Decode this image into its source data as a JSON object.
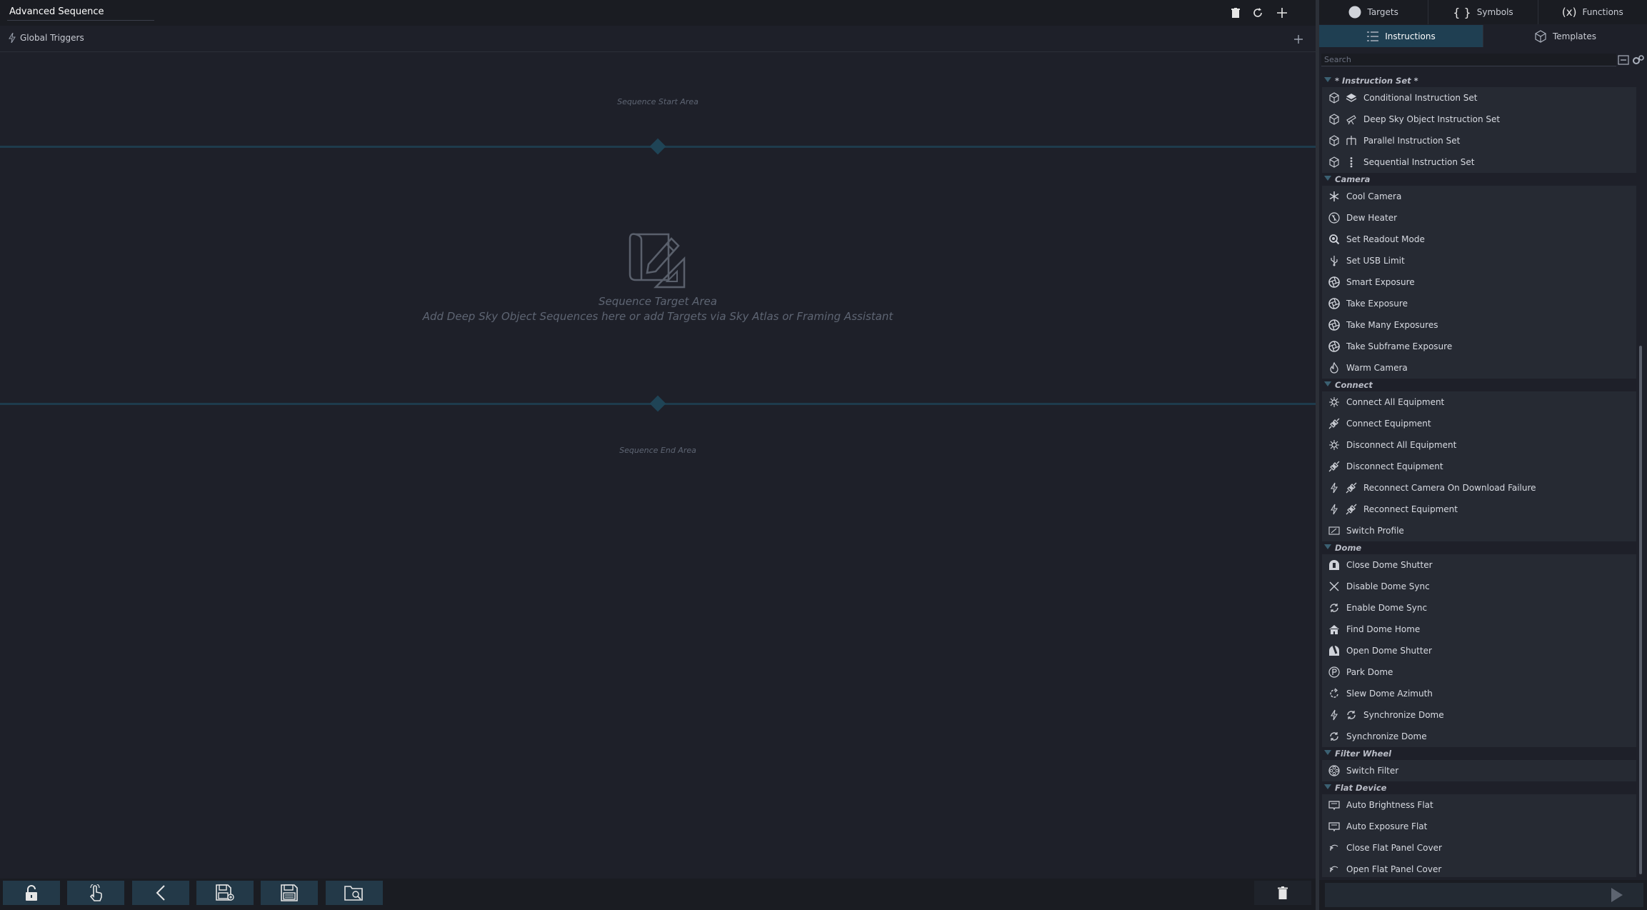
{
  "sequence": {
    "name": "Advanced Sequence",
    "global_triggers_label": "Global Triggers",
    "start_area_label": "Sequence Start Area",
    "target_area_title": "Sequence Target Area",
    "target_area_hint": "Add Deep Sky Object Sequences here or add Targets via Sky Atlas or Framing Assistant",
    "end_area_label": "Sequence End Area"
  },
  "tabs_top": [
    {
      "label": "Targets",
      "icon": "circle-icon"
    },
    {
      "label": "Symbols",
      "icon": "braces-icon"
    },
    {
      "label": "Functions",
      "icon": "function-x-icon"
    }
  ],
  "tabs_bottom": [
    {
      "label": "Instructions",
      "icon": "list-icon",
      "active": true
    },
    {
      "label": "Templates",
      "icon": "cube-icon",
      "active": false
    }
  ],
  "search": {
    "placeholder": "Search"
  },
  "categories": [
    {
      "name": "* Instruction Set *",
      "items": [
        {
          "label": "Conditional Instruction Set",
          "icon": "cube-icon",
          "icon2": "layers-icon"
        },
        {
          "label": "Deep Sky Object Instruction Set",
          "icon": "cube-icon",
          "icon2": "telescope-icon"
        },
        {
          "label": "Parallel Instruction Set",
          "icon": "cube-icon",
          "icon2": "parallel-icon"
        },
        {
          "label": "Sequential Instruction Set",
          "icon": "cube-icon",
          "icon2": "dots-vertical-icon"
        }
      ]
    },
    {
      "name": "Camera",
      "items": [
        {
          "label": "Cool Camera",
          "icon": "snowflake-icon"
        },
        {
          "label": "Dew Heater",
          "icon": "dew-heater-icon"
        },
        {
          "label": "Set Readout Mode",
          "icon": "magnifier-icon"
        },
        {
          "label": "Set USB Limit",
          "icon": "usb-icon"
        },
        {
          "label": "Smart Exposure",
          "icon": "aperture-icon"
        },
        {
          "label": "Take Exposure",
          "icon": "aperture-icon"
        },
        {
          "label": "Take Many Exposures",
          "icon": "aperture-icon"
        },
        {
          "label": "Take Subframe Exposure",
          "icon": "aperture-icon"
        },
        {
          "label": "Warm Camera",
          "icon": "flame-icon"
        }
      ]
    },
    {
      "name": "Connect",
      "items": [
        {
          "label": "Connect All Equipment",
          "icon": "plug-all-icon"
        },
        {
          "label": "Connect Equipment",
          "icon": "plug-icon"
        },
        {
          "label": "Disconnect All Equipment",
          "icon": "plug-all-icon"
        },
        {
          "label": "Disconnect Equipment",
          "icon": "plug-icon"
        },
        {
          "label": "Reconnect Camera On Download Failure",
          "icon": "lightning-icon",
          "icon2": "plug-icon"
        },
        {
          "label": "Reconnect Equipment",
          "icon": "lightning-icon",
          "icon2": "plug-icon"
        },
        {
          "label": "Switch Profile",
          "icon": "profile-icon"
        }
      ]
    },
    {
      "name": "Dome",
      "items": [
        {
          "label": "Close Dome Shutter",
          "icon": "dome-closed-icon"
        },
        {
          "label": "Disable Dome Sync",
          "icon": "cross-icon"
        },
        {
          "label": "Enable Dome Sync",
          "icon": "sync-icon"
        },
        {
          "label": "Find Dome Home",
          "icon": "home-icon"
        },
        {
          "label": "Open Dome Shutter",
          "icon": "dome-open-icon"
        },
        {
          "label": "Park Dome",
          "icon": "park-icon"
        },
        {
          "label": "Slew Dome Azimuth",
          "icon": "rotate-icon"
        },
        {
          "label": "Synchronize Dome",
          "icon": "lightning-icon",
          "icon2": "sync-icon"
        },
        {
          "label": "Synchronize Dome",
          "icon": "sync-icon"
        }
      ]
    },
    {
      "name": "Filter Wheel",
      "items": [
        {
          "label": "Switch Filter",
          "icon": "filter-wheel-icon"
        }
      ]
    },
    {
      "name": "Flat Device",
      "items": [
        {
          "label": "Auto Brightness Flat",
          "icon": "flat-panel-icon"
        },
        {
          "label": "Auto Exposure Flat",
          "icon": "flat-panel-icon"
        },
        {
          "label": "Close Flat Panel Cover",
          "icon": "flat-cover-icon"
        },
        {
          "label": "Open Flat Panel Cover",
          "icon": "flat-cover-icon"
        }
      ]
    }
  ],
  "colors": {
    "background": "#1e2029",
    "accent": "#1f3f52",
    "item_bg": "#262a33",
    "divider": "#1e3b4c"
  }
}
